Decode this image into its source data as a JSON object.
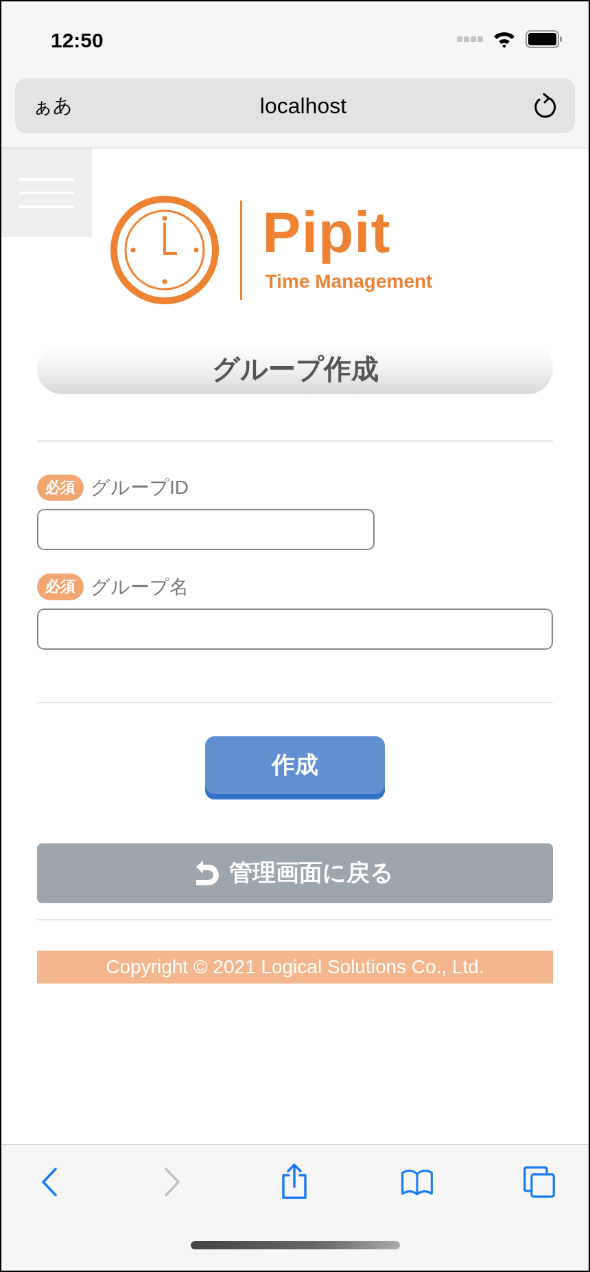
{
  "status_bar": {
    "time": "12:50"
  },
  "address_bar": {
    "text_size_button": "ぁあ",
    "url": "localhost"
  },
  "logo": {
    "name": "Pipit",
    "tagline": "Time Management"
  },
  "page_title": "グループ作成",
  "fields": [
    {
      "badge": "必須",
      "label": "グループID",
      "required": true
    },
    {
      "badge": "必須",
      "label": "グループ名",
      "required": true
    }
  ],
  "submit_button": "作成",
  "back_button": "管理画面に戻る",
  "copyright": "Copyright © 2021 Logical Solutions Co., Ltd.",
  "toolbar": [
    {
      "kind": "back",
      "disabled": false
    },
    {
      "kind": "forward",
      "disabled": true
    },
    {
      "kind": "share",
      "disabled": false
    },
    {
      "kind": "bookmarks",
      "disabled": false
    },
    {
      "kind": "tabs",
      "disabled": false
    }
  ]
}
